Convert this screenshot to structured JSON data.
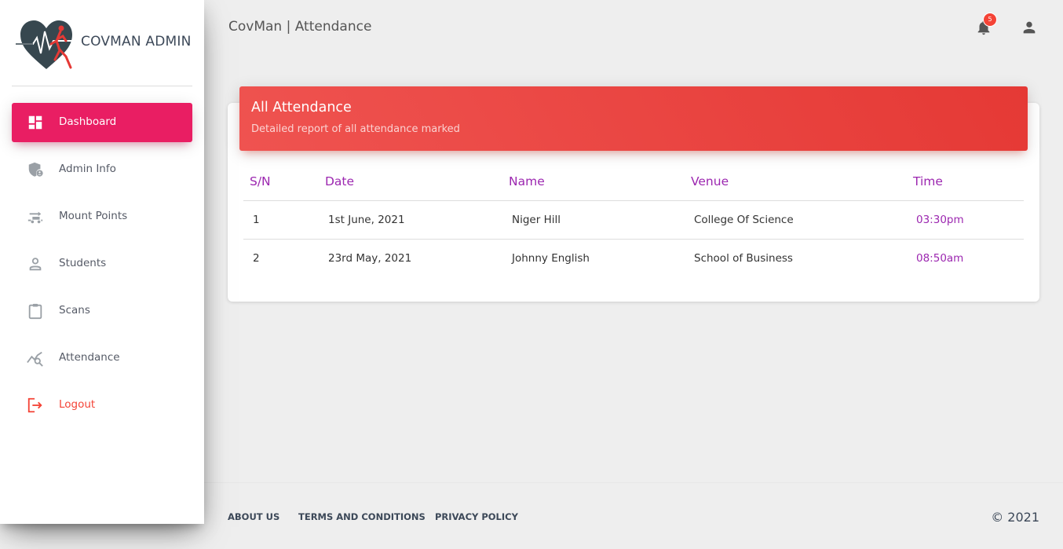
{
  "app": {
    "logo_text": "COVMAN ADMIN",
    "page_title": "CovMan | Attendance"
  },
  "sidebar": {
    "items": [
      {
        "label": "Dashboard",
        "icon": "dashboard-icon"
      },
      {
        "label": "Admin Info",
        "icon": "admin-shield-icon"
      },
      {
        "label": "Mount Points",
        "icon": "mount-points-icon"
      },
      {
        "label": "Students",
        "icon": "person-icon"
      },
      {
        "label": "Scans",
        "icon": "clipboard-icon"
      },
      {
        "label": "Attendance",
        "icon": "attendance-chart-icon"
      },
      {
        "label": "Logout",
        "icon": "logout-icon"
      }
    ]
  },
  "header": {
    "notification_count": "5"
  },
  "card": {
    "title": "All Attendance",
    "subtitle": "Detailed report of all attendance marked",
    "columns": [
      "S/N",
      "Date",
      "Name",
      "Venue",
      "Time"
    ],
    "rows": [
      [
        "1",
        "1st June, 2021",
        "Niger Hill",
        "College Of Science",
        "03:30pm"
      ],
      [
        "2",
        "23rd May, 2021",
        "Johnny English",
        "School of Business",
        "08:50am"
      ]
    ]
  },
  "footer": {
    "links": [
      "ABOUT US",
      "TERMS AND CONDITIONS",
      "PRIVACY POLICY"
    ],
    "copyright": "© 2021"
  },
  "colors": {
    "active": "#e91e63",
    "header_red": "#ef5350",
    "accent_purple": "#9c27b0",
    "logout_red": "#f44336"
  }
}
